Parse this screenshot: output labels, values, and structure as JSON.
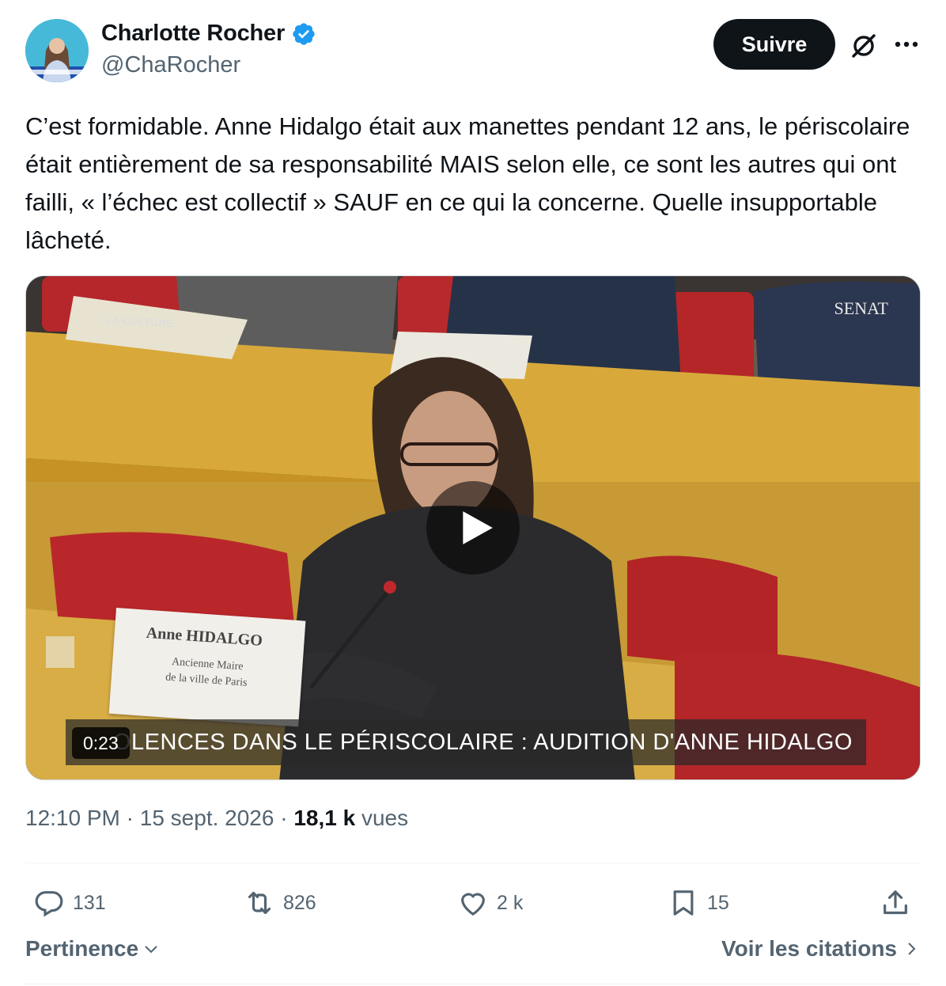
{
  "author": {
    "display_name": "Charlotte Rocher",
    "handle": "@ChaRocher",
    "verified": true,
    "avatar_icon": "avatar-photo"
  },
  "header": {
    "follow_label": "Suivre",
    "grok_icon": "grok-icon",
    "more_icon": "more-icon"
  },
  "tweet": {
    "text": "C’est formidable. Anne Hidalgo était aux manettes pendant 12 ans, le périscolaire était entièrement de sa responsabilité MAIS selon elle, ce sont les autres qui ont failli, « l’échec est collectif » SAUF en ce qui la concerne. Quelle insupportable lâcheté."
  },
  "media": {
    "type": "video",
    "duration": "0:23",
    "banner_text": "OLENCES DANS LE PÉRISCOLAIRE : AUDITION D'ANNE HIDALGO",
    "nameplate_name": "Anne HIDALGO",
    "nameplate_line1": "Ancienne Maire",
    "nameplate_line2": "de la ville de Paris",
    "channel_logo": "SENAT",
    "desk_label": "LA CULTURE"
  },
  "meta": {
    "time": "12:10 PM",
    "separator": " · ",
    "date": "15 sept. 2026",
    "views_count": "18,1 k",
    "views_label": "vues"
  },
  "actions": {
    "replies": "131",
    "reposts": "826",
    "likes": "2 k",
    "bookmarks": "15"
  },
  "footer": {
    "sort_label": "Pertinence",
    "quotes_label": "Voir les citations"
  },
  "colors": {
    "text_primary": "#0f1419",
    "text_secondary": "#536471",
    "verified_blue": "#1d9bf0",
    "follow_bg": "#0f1419"
  }
}
